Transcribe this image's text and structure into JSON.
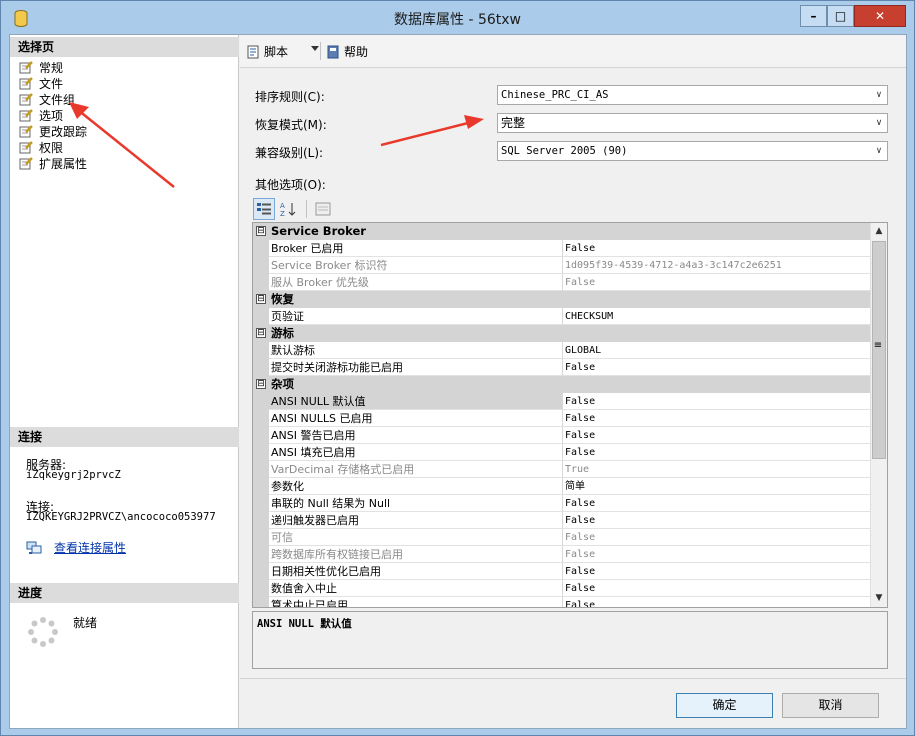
{
  "window": {
    "title": "数据库属性 - 56txw",
    "min_label": "–",
    "max_label": "□",
    "close_label": "✕"
  },
  "left": {
    "select_page_header": "选择页",
    "nav_items": [
      {
        "label": "常规",
        "icon": "page-wrench-icon"
      },
      {
        "label": "文件",
        "icon": "page-wrench-icon"
      },
      {
        "label": "文件组",
        "icon": "page-wrench-icon"
      },
      {
        "label": "选项",
        "icon": "page-wrench-icon"
      },
      {
        "label": "更改跟踪",
        "icon": "page-wrench-icon"
      },
      {
        "label": "权限",
        "icon": "page-wrench-icon"
      },
      {
        "label": "扩展属性",
        "icon": "page-wrench-icon"
      }
    ],
    "connection_header": "连接",
    "server_label": "服务器:",
    "server_value": "iZqkeygrj2prvcZ",
    "connect_label": "连接:",
    "connect_value": "IZQKEYGRJ2PRVCZ\\ancococo053977",
    "view_link": "查看连接属性",
    "progress_header": "进度",
    "progress_status": "就绪"
  },
  "toolbar": {
    "script_label": "脚本",
    "help_label": "帮助"
  },
  "form": {
    "collation_label": "排序规则(C):",
    "collation_value": "Chinese_PRC_CI_AS",
    "recovery_label": "恢复模式(M):",
    "recovery_value": "完整",
    "compat_label": "兼容级别(L):",
    "compat_value": "SQL Server 2005 (90)",
    "other_label": "其他选项(O):",
    "dropdown_glyph": "∨"
  },
  "grid": {
    "categories": [
      {
        "title": "Service Broker",
        "rows": [
          {
            "name": "Broker 已启用",
            "value": "False",
            "disabled": false
          },
          {
            "name": "Service Broker 标识符",
            "value": "1d095f39-4539-4712-a4a3-3c147c2e6251",
            "disabled": true
          },
          {
            "name": "服从 Broker 优先级",
            "value": "False",
            "disabled": true
          }
        ]
      },
      {
        "title": "恢复",
        "rows": [
          {
            "name": "页验证",
            "value": "CHECKSUM",
            "disabled": false
          }
        ]
      },
      {
        "title": "游标",
        "rows": [
          {
            "name": "默认游标",
            "value": "GLOBAL",
            "disabled": false
          },
          {
            "name": "提交时关闭游标功能已启用",
            "value": "False",
            "disabled": false
          }
        ]
      },
      {
        "title": "杂项",
        "rows": [
          {
            "name": "ANSI NULL 默认值",
            "value": "False",
            "disabled": false,
            "selected": true
          },
          {
            "name": "ANSI NULLS 已启用",
            "value": "False",
            "disabled": false
          },
          {
            "name": "ANSI 警告已启用",
            "value": "False",
            "disabled": false
          },
          {
            "name": "ANSI 填充已启用",
            "value": "False",
            "disabled": false
          },
          {
            "name": "VarDecimal 存储格式已启用",
            "value": "True",
            "disabled": true
          },
          {
            "name": "参数化",
            "value": "简单",
            "disabled": false
          },
          {
            "name": "串联的 Null 结果为 Null",
            "value": "False",
            "disabled": false
          },
          {
            "name": "递归触发器已启用",
            "value": "False",
            "disabled": false
          },
          {
            "name": "可信",
            "value": "False",
            "disabled": true
          },
          {
            "name": "跨数据库所有权链接已启用",
            "value": "False",
            "disabled": true
          },
          {
            "name": "日期相关性优化已启用",
            "value": "False",
            "disabled": false
          },
          {
            "name": "数值舍入中止",
            "value": "False",
            "disabled": false
          },
          {
            "name": "算术中止已启用",
            "value": "False",
            "disabled": false
          }
        ]
      }
    ],
    "collapse_glyph": "⊟",
    "description": "ANSI NULL 默认值"
  },
  "buttons": {
    "ok": "确定",
    "cancel": "取消"
  },
  "colors": {
    "title_bar": "#aacbea",
    "annotation_arrow": "#e8392b",
    "link": "#0033aa"
  }
}
